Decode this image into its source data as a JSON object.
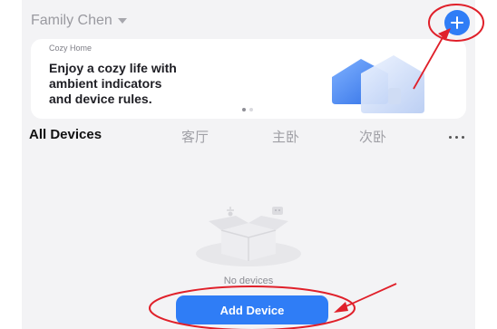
{
  "header": {
    "home_name": "Family Chen",
    "add_icon": "plus-icon"
  },
  "banner": {
    "brand": "Cozy Home",
    "message": "Enjoy a cozy life with\nambient indicators\nand device rules.",
    "pages": 2,
    "active_page": 1
  },
  "tabs": [
    "All Devices",
    "客厅",
    "主卧",
    "次卧"
  ],
  "empty_state": {
    "message": "No devices",
    "button_label": "Add Device"
  },
  "colors": {
    "accent": "#2f7df6",
    "annotation": "#e0202a"
  }
}
